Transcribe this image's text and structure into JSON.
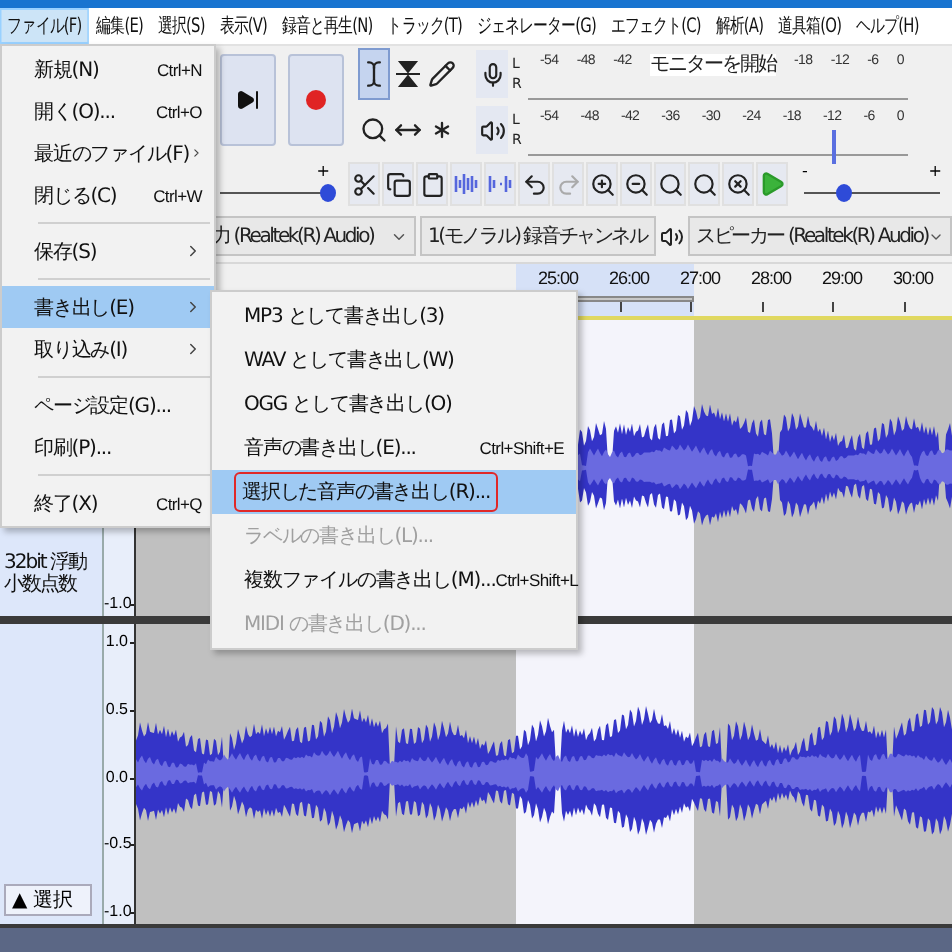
{
  "menubar": [
    {
      "label": "ファイル(F)",
      "selected": true
    },
    {
      "label": "編集(E)",
      "selected": false
    },
    {
      "label": "選択(S)",
      "selected": false
    },
    {
      "label": "表示(V)",
      "selected": false
    },
    {
      "label": "録音と再生(N)",
      "selected": false
    },
    {
      "label": "トラック(T)",
      "selected": false
    },
    {
      "label": "ジェネレーター(G)",
      "selected": false
    },
    {
      "label": "エフェクト(C)",
      "selected": false
    },
    {
      "label": "解析(A)",
      "selected": false
    },
    {
      "label": "道具箱(O)",
      "selected": false
    },
    {
      "label": "ヘルプ(H)",
      "selected": false
    }
  ],
  "transport": [
    {
      "kind": "skip_end"
    },
    {
      "kind": "record"
    }
  ],
  "tools": [
    {
      "kind": "select",
      "selected": true
    },
    {
      "kind": "envelope",
      "selected": false
    },
    {
      "kind": "draw",
      "selected": false
    },
    {
      "kind": "zoom",
      "selected": false
    },
    {
      "kind": "time_shift",
      "selected": false
    },
    {
      "kind": "multi",
      "selected": false
    }
  ],
  "meters": [
    {
      "kind": "record",
      "channels": [
        "L",
        "R"
      ],
      "scale": [
        {
          "kind": "tick",
          "text": "-54"
        },
        {
          "kind": "tick",
          "text": "-48"
        },
        {
          "kind": "tick",
          "text": "-42"
        },
        {
          "kind": "overlay",
          "text": "モニターを開始"
        },
        {
          "kind": "tick",
          "text": "-18"
        },
        {
          "kind": "tick",
          "text": "-12"
        },
        {
          "kind": "tick",
          "text": "-6"
        },
        {
          "kind": "tick",
          "text": "0"
        }
      ]
    },
    {
      "kind": "playback",
      "channels": [
        "L",
        "R"
      ],
      "level": 0.8,
      "scale": [
        {
          "kind": "tick",
          "text": "-54"
        },
        {
          "kind": "tick",
          "text": "-48"
        },
        {
          "kind": "tick",
          "text": "-42"
        },
        {
          "kind": "tick",
          "text": "-36"
        },
        {
          "kind": "tick",
          "text": "-30"
        },
        {
          "kind": "tick",
          "text": "-24"
        },
        {
          "kind": "tick",
          "text": "-18"
        },
        {
          "kind": "tick",
          "text": "-12"
        },
        {
          "kind": "tick",
          "text": "-6"
        },
        {
          "kind": "tick",
          "text": "0"
        }
      ]
    }
  ],
  "gain_slider": {
    "plus": "+",
    "level": 1
  },
  "edit_tools": [
    {
      "kind": "cut",
      "disabled": false
    },
    {
      "kind": "copy",
      "disabled": false
    },
    {
      "kind": "paste",
      "disabled": false
    },
    {
      "kind": "trim",
      "disabled": false
    },
    {
      "kind": "silence",
      "disabled": false
    },
    {
      "kind": "undo",
      "disabled": false
    },
    {
      "kind": "redo",
      "disabled": true
    },
    {
      "kind": "zoom_in",
      "disabled": false
    },
    {
      "kind": "zoom_out",
      "disabled": false
    },
    {
      "kind": "fit_selection",
      "disabled": false
    },
    {
      "kind": "fit_project",
      "disabled": false
    },
    {
      "kind": "zoom_toggle",
      "disabled": false
    },
    {
      "kind": "play",
      "disabled": false
    }
  ],
  "speed_slider": {
    "minus": "-",
    "plus": "+",
    "level": 0.3
  },
  "devices": {
    "input": "力 (Realtek(R) Audio)",
    "channels": "1(モノラル) 録音チャンネル",
    "output": "スピーカー (Realtek(R) Audio)"
  },
  "timeline": {
    "labels": [
      "25:00",
      "26:00",
      "27:00",
      "28:00",
      "29:00",
      "30:00"
    ]
  },
  "tracks": [
    {
      "format": "32bit 浮動小数点数",
      "scale": [
        "-1.0"
      ]
    },
    {
      "scale": [
        "1.0",
        "0.5",
        "0.0",
        "-0.5",
        "-1.0"
      ],
      "select_button": {
        "arrow": "▲",
        "label": "選択"
      }
    }
  ],
  "file_menu": [
    [
      {
        "label": "新規(N)",
        "shortcut": "Ctrl+N",
        "has_submenu": false,
        "selected": false
      },
      {
        "label": "開く(O)...",
        "shortcut": "Ctrl+O",
        "has_submenu": false,
        "selected": false
      },
      {
        "label": "最近のファイル(F)",
        "has_submenu": true,
        "selected": false
      },
      {
        "label": "閉じる(C)",
        "shortcut": "Ctrl+W",
        "has_submenu": false,
        "selected": false
      }
    ],
    [
      {
        "label": "保存(S)",
        "has_submenu": true,
        "selected": false
      }
    ],
    [
      {
        "label": "書き出し(E)",
        "has_submenu": true,
        "selected": true
      },
      {
        "label": "取り込み(I)",
        "has_submenu": true,
        "selected": false
      }
    ],
    [
      {
        "label": "ページ設定(G)...",
        "has_submenu": false,
        "selected": false
      },
      {
        "label": "印刷(P)...",
        "has_submenu": false,
        "selected": false
      }
    ],
    [
      {
        "label": "終了(X)",
        "shortcut": "Ctrl+Q",
        "has_submenu": false,
        "selected": false
      }
    ]
  ],
  "export_submenu": [
    {
      "label": "MP3 として書き出し(3)",
      "selected": false,
      "disabled": false,
      "outlined": false
    },
    {
      "label": "WAV として書き出し(W)",
      "selected": false,
      "disabled": false,
      "outlined": false
    },
    {
      "label": "OGG として書き出し(O)",
      "selected": false,
      "disabled": false,
      "outlined": false
    },
    {
      "label": "音声の書き出し(E)...",
      "shortcut": "Ctrl+Shift+E",
      "selected": false,
      "disabled": false,
      "outlined": false
    },
    {
      "label": "選択した音声の書き出し(R)...",
      "selected": true,
      "disabled": false,
      "outlined": true
    },
    {
      "label": "ラベルの書き出し(L)...",
      "selected": false,
      "disabled": true,
      "outlined": false
    },
    {
      "label": "複数ファイルの書き出し(M)...",
      "shortcut": "Ctrl+Shift+L",
      "selected": false,
      "disabled": false,
      "outlined": false
    },
    {
      "label": "MIDI の書き出し(D)...",
      "selected": false,
      "disabled": true,
      "outlined": false
    }
  ]
}
